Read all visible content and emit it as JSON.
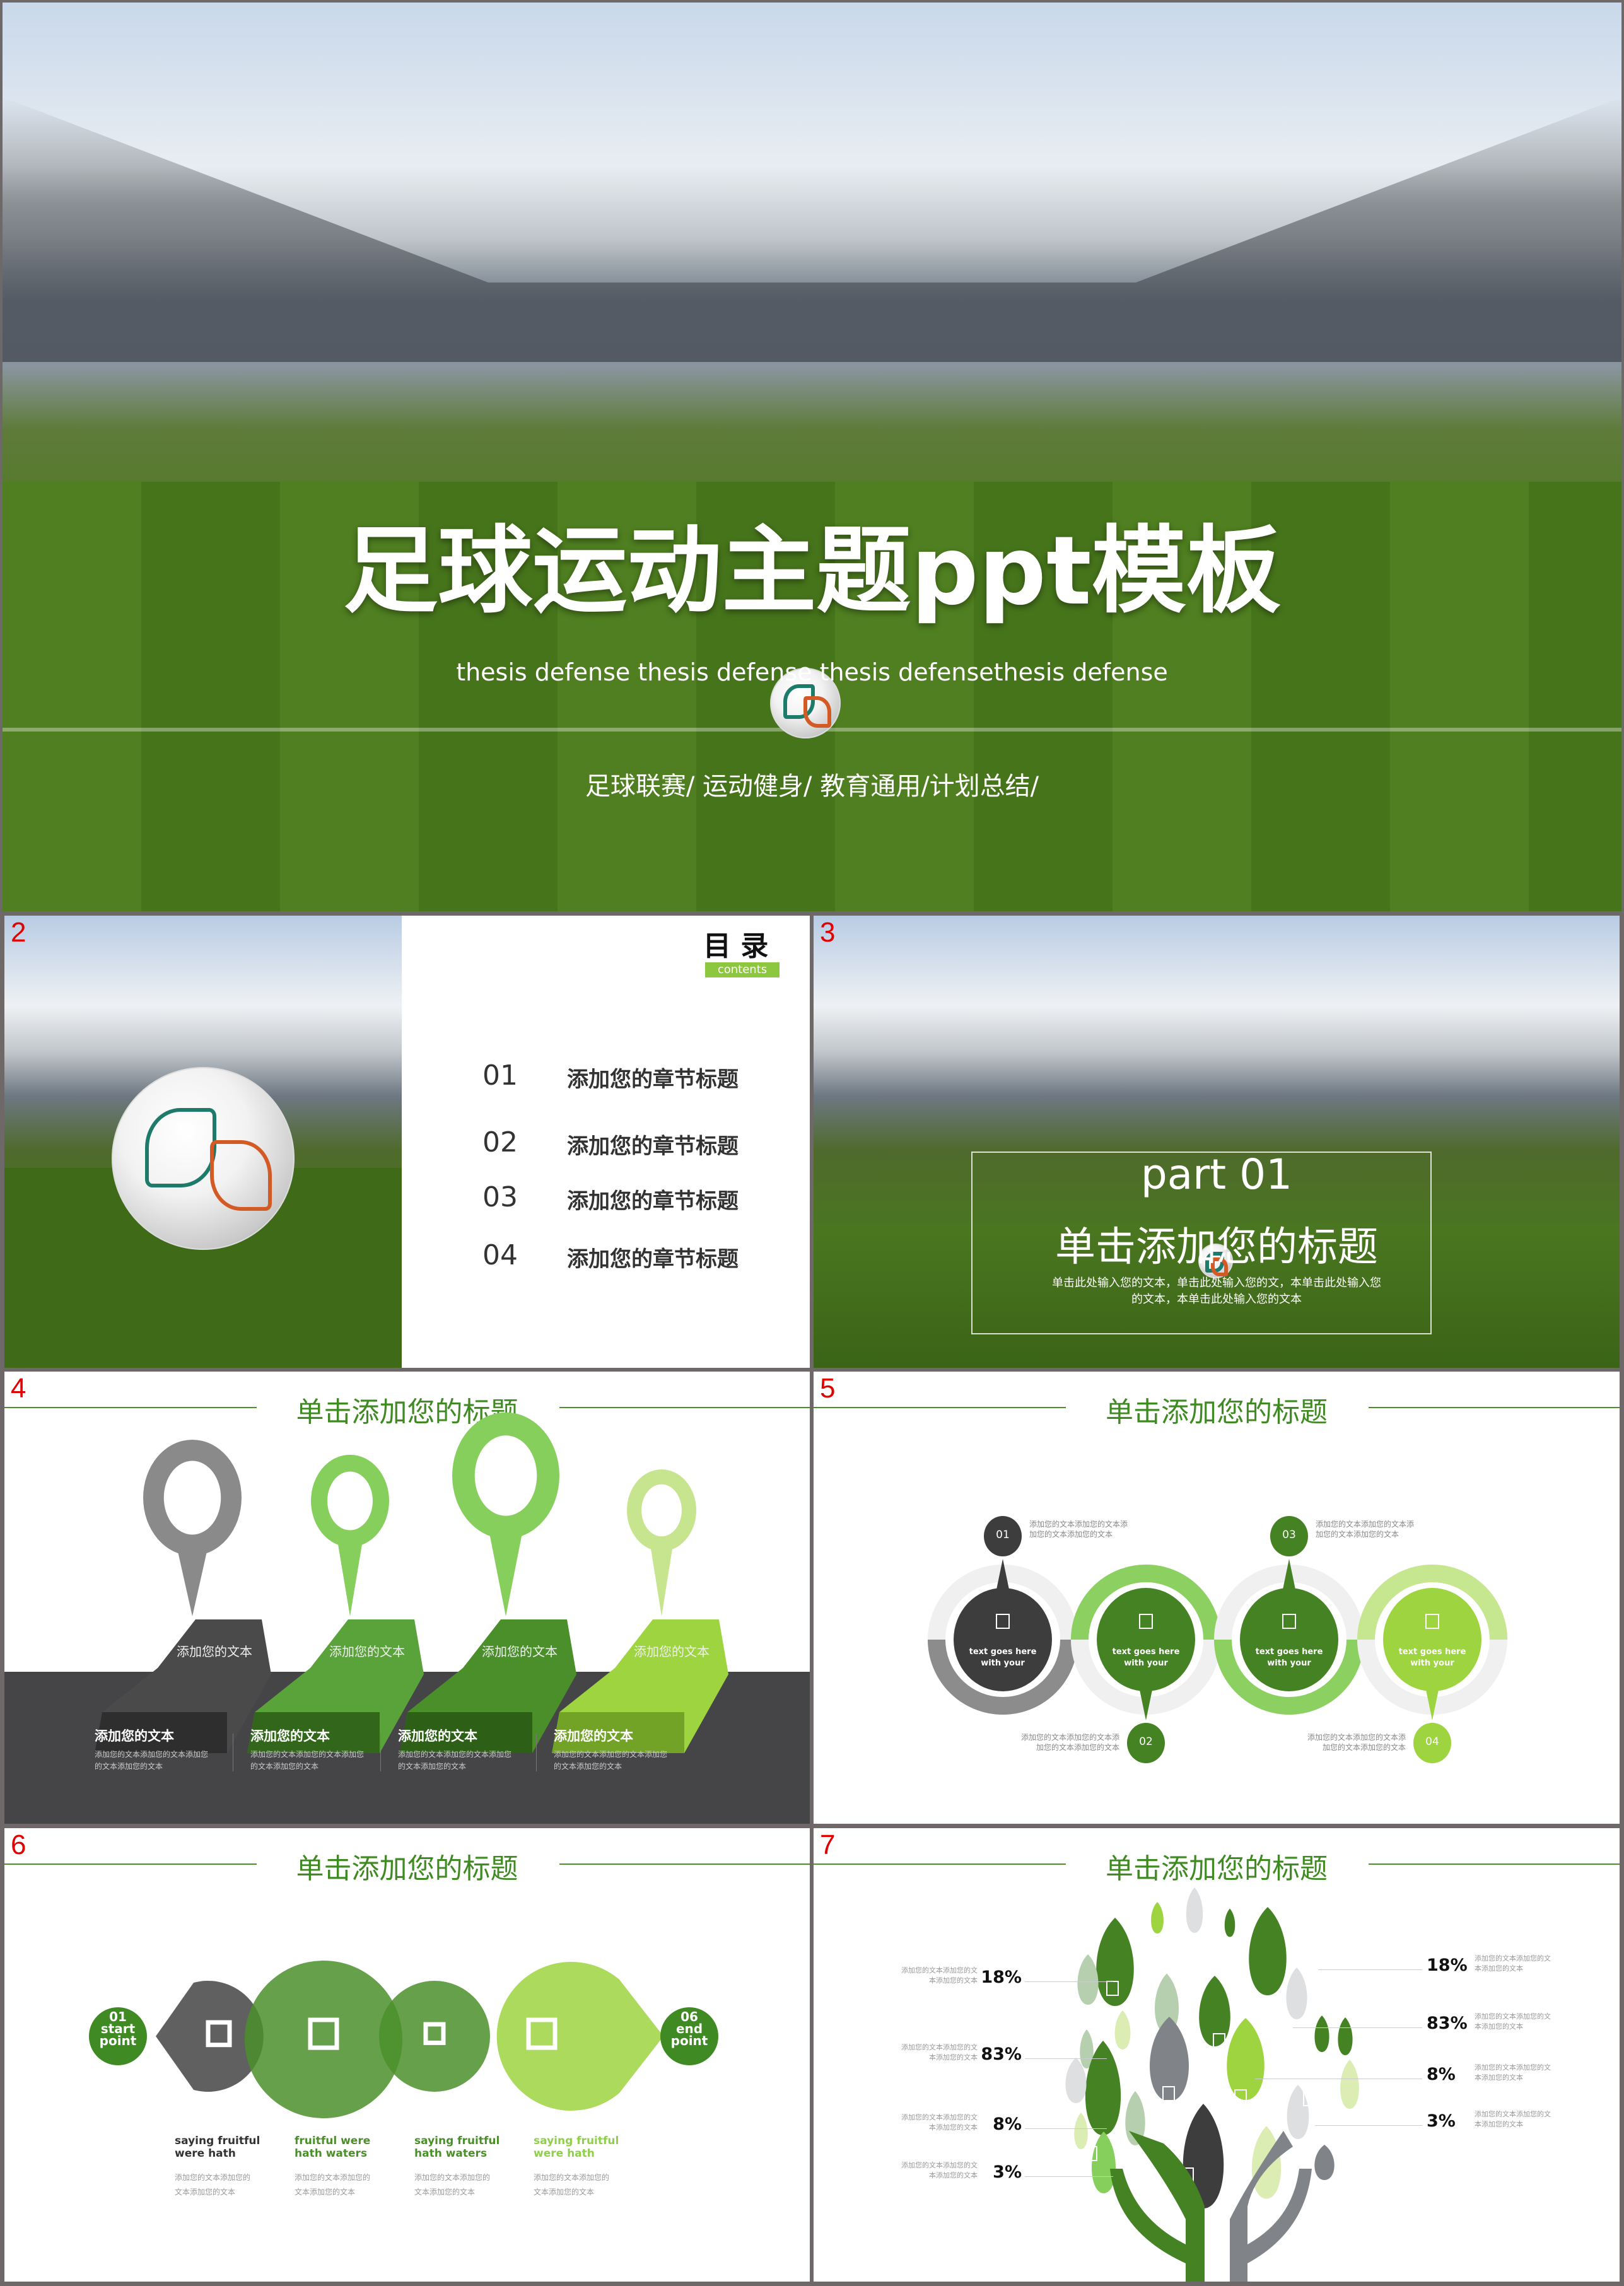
{
  "slide1": {
    "title": "足球运动主题ppt模板",
    "subtitle": "thesis defense thesis defense thesis defensethesis defense",
    "tags": "足球联赛/ 运动健身/ 教育通用/计划总结/"
  },
  "slide2": {
    "number": "2",
    "title": "目 录",
    "badge": "contents",
    "items": [
      {
        "num": "01",
        "label": "添加您的章节标题"
      },
      {
        "num": "02",
        "label": "添加您的章节标题"
      },
      {
        "num": "03",
        "label": "添加您的章节标题"
      },
      {
        "num": "04",
        "label": "添加您的章节标题"
      }
    ]
  },
  "slide3": {
    "number": "3",
    "part": "part 01",
    "title": "单击添加您的标题",
    "body1": "单击此处输入您的文本，单击此处输入您的文，本单击此处输入您",
    "body2": "的文本，本单击此处输入您的文本"
  },
  "slide4": {
    "number": "4",
    "title": "单击添加您的标题",
    "blocks": [
      "添加您的文本",
      "添加您的文本",
      "添加您的文本",
      "添加您的文本"
    ],
    "columns": [
      {
        "heading": "添加您的文本",
        "body1": "添加您的文本添加您的文本添加您",
        "body2": "的文本添加您的文本"
      },
      {
        "heading": "添加您的文本",
        "body1": "添加您的文本添加您的文本添加您",
        "body2": "的文本添加您的文本"
      },
      {
        "heading": "添加您的文本",
        "body1": "添加您的文本添加您的文本添加您",
        "body2": "的文本添加您的文本"
      },
      {
        "heading": "添加您的文本",
        "body1": "添加您的文本添加您的文本添加您",
        "body2": "的文本添加您的文本"
      }
    ],
    "colors": [
      "#444444",
      "#4b8f2b",
      "#3f8a22",
      "#8fcf4a"
    ]
  },
  "slide5": {
    "number": "5",
    "title": "单击添加您的标题",
    "steps": [
      {
        "num": "01",
        "label1": "text goes here",
        "label2": "with your",
        "note1": "添加您的文本添加您的文本添",
        "note2": "加您的文本添加您的文本",
        "color": "#3d3d3d"
      },
      {
        "num": "02",
        "label1": "text goes here",
        "label2": "with your",
        "note1": "添加您的文本添加您的文本添",
        "note2": "加您的文本添加您的文本",
        "color": "#448224"
      },
      {
        "num": "03",
        "label1": "text goes here",
        "label2": "with your",
        "note1": "添加您的文本添加您的文本添",
        "note2": "加您的文本添加您的文本",
        "color": "#448224"
      },
      {
        "num": "04",
        "label1": "text goes here",
        "label2": "with your",
        "note1": "添加您的文本添加您的文本添",
        "note2": "加您的文本添加您的文本",
        "color": "#9ed440"
      }
    ]
  },
  "slide6": {
    "number": "6",
    "title": "单击添加您的标题",
    "start": {
      "num": "01",
      "l1": "start",
      "l2": "point"
    },
    "end": {
      "num": "06",
      "l1": "end",
      "l2": "point"
    },
    "columns": [
      {
        "h1": "saying fruitful",
        "h2": "were hath",
        "b1": "添加您的文本添加您的",
        "b2": "文本添加您的文本",
        "color": "#333333"
      },
      {
        "h1": "fruitful were",
        "h2": "hath waters",
        "b1": "添加您的文本添加您的",
        "b2": "文本添加您的文本",
        "color": "#4b8f2b"
      },
      {
        "h1": "saying fruitful",
        "h2": "hath waters",
        "b1": "添加您的文本添加您的",
        "b2": "文本添加您的文本",
        "color": "#4b8f2b"
      },
      {
        "h1": "saying fruitful",
        "h2": "were hath",
        "b1": "添加您的文本添加您的",
        "b2": "文本添加您的文本",
        "color": "#8fcf4a"
      }
    ]
  },
  "slide7": {
    "number": "7",
    "title": "单击添加您的标题",
    "left": [
      {
        "value": "18%",
        "t1": "添加您的文本添加您的文",
        "t2": "本添加您的文本"
      },
      {
        "value": "83%",
        "t1": "添加您的文本添加您的文",
        "t2": "本添加您的文本"
      },
      {
        "value": "8%",
        "t1": "添加您的文本添加您的文",
        "t2": "本添加您的文本"
      },
      {
        "value": "3%",
        "t1": "添加您的文本添加您的文",
        "t2": "本添加您的文本"
      }
    ],
    "right": [
      {
        "value": "18%",
        "t1": "添加您的文本添加您的文",
        "t2": "本添加您的文本"
      },
      {
        "value": "83%",
        "t1": "添加您的文本添加您的文",
        "t2": "本添加您的文本"
      },
      {
        "value": "8%",
        "t1": "添加您的文本添加您的文",
        "t2": "本添加您的文本"
      },
      {
        "value": "3%",
        "t1": "添加您的文本添加您的文",
        "t2": "本添加您的文本"
      }
    ]
  }
}
